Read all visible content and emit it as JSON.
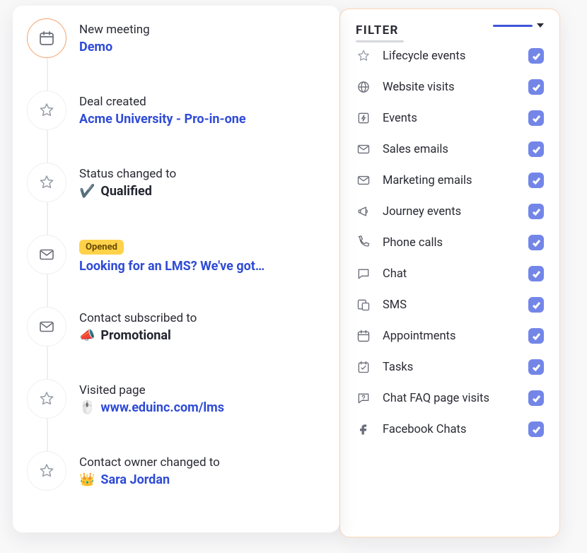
{
  "timeline": [
    {
      "icon": "calendar",
      "active": true,
      "label": "New meeting",
      "value": "Demo",
      "valueClass": "link-blue"
    },
    {
      "icon": "star",
      "label": "Deal created",
      "value": "Acme University - Pro-in-one",
      "valueClass": "link-blue"
    },
    {
      "icon": "star",
      "label": "Status changed to",
      "emoji": "✔️",
      "value": "Qualified",
      "valueClass": "txt-dark"
    },
    {
      "icon": "mail",
      "badge": "Opened",
      "value": "Looking for an LMS? We've got…",
      "valueClass": "link-blue"
    },
    {
      "icon": "mail",
      "label": "Contact subscribed to",
      "emoji": "📣",
      "value": "Promotional",
      "valueClass": "txt-dark"
    },
    {
      "icon": "star",
      "label": "Visited page",
      "emoji": "🖱️",
      "value": "www.eduinc.com/lms",
      "valueClass": "link-blue"
    },
    {
      "icon": "star",
      "label": "Contact owner changed to",
      "emoji": "👑",
      "value": "Sara Jordan",
      "valueClass": "link-blue"
    }
  ],
  "filter": {
    "title": "FILTER",
    "items": [
      {
        "icon": "star",
        "label": "Lifecycle events",
        "checked": true
      },
      {
        "icon": "globe",
        "label": "Website visits",
        "checked": true
      },
      {
        "icon": "bolt-page",
        "label": "Events",
        "checked": true
      },
      {
        "icon": "mail",
        "label": "Sales emails",
        "checked": true
      },
      {
        "icon": "mail",
        "label": "Marketing emails",
        "checked": true
      },
      {
        "icon": "megaphone",
        "label": "Journey events",
        "checked": true
      },
      {
        "icon": "phone",
        "label": "Phone calls",
        "checked": true
      },
      {
        "icon": "chat",
        "label": "Chat",
        "checked": true
      },
      {
        "icon": "sms",
        "label": "SMS",
        "checked": true
      },
      {
        "icon": "calendar",
        "label": "Appointments",
        "checked": true
      },
      {
        "icon": "task",
        "label": "Tasks",
        "checked": true
      },
      {
        "icon": "faq",
        "label": "Chat FAQ page visits",
        "checked": true
      },
      {
        "icon": "facebook",
        "label": "Facebook Chats",
        "checked": true
      }
    ]
  }
}
